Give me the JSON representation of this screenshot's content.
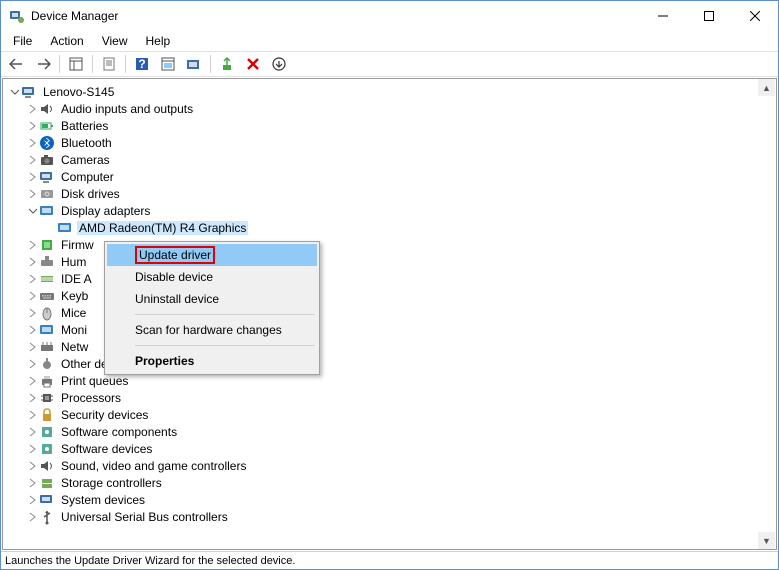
{
  "window": {
    "title": "Device Manager"
  },
  "menubar": [
    "File",
    "Action",
    "View",
    "Help"
  ],
  "root": "Lenovo-S145",
  "categories": [
    {
      "label": "Audio inputs and outputs",
      "icon": "speaker"
    },
    {
      "label": "Batteries",
      "icon": "battery"
    },
    {
      "label": "Bluetooth",
      "icon": "bluetooth"
    },
    {
      "label": "Cameras",
      "icon": "camera"
    },
    {
      "label": "Computer",
      "icon": "computer"
    },
    {
      "label": "Disk drives",
      "icon": "disk"
    }
  ],
  "display_adapters": {
    "label": "Display adapters",
    "child": "AMD Radeon(TM) R4 Graphics"
  },
  "truncated": [
    {
      "label": "Firmw",
      "icon": "firmware"
    },
    {
      "label": "Hum",
      "icon": "hid"
    },
    {
      "label": "IDE A",
      "icon": "ide"
    },
    {
      "label": "Keyb",
      "icon": "keyboard"
    },
    {
      "label": "Mice",
      "icon": "mouse"
    },
    {
      "label": "Moni",
      "icon": "monitor"
    },
    {
      "label": "Netw",
      "icon": "network"
    }
  ],
  "rest": [
    {
      "label": "Other devices",
      "icon": "other"
    },
    {
      "label": "Print queues",
      "icon": "printer"
    },
    {
      "label": "Processors",
      "icon": "cpu"
    },
    {
      "label": "Security devices",
      "icon": "security"
    },
    {
      "label": "Software components",
      "icon": "software"
    },
    {
      "label": "Software devices",
      "icon": "software"
    },
    {
      "label": "Sound, video and game controllers",
      "icon": "sound"
    },
    {
      "label": "Storage controllers",
      "icon": "storage"
    },
    {
      "label": "System devices",
      "icon": "system"
    },
    {
      "label": "Universal Serial Bus controllers",
      "icon": "usb"
    }
  ],
  "context_menu": {
    "items": [
      {
        "label": "Update driver",
        "highlight": true,
        "redbox": true
      },
      {
        "label": "Disable device"
      },
      {
        "label": "Uninstall device"
      },
      {
        "sep": true
      },
      {
        "label": "Scan for hardware changes"
      },
      {
        "sep": true
      },
      {
        "label": "Properties",
        "bold": true
      }
    ]
  },
  "statusbar": "Launches the Update Driver Wizard for the selected device."
}
